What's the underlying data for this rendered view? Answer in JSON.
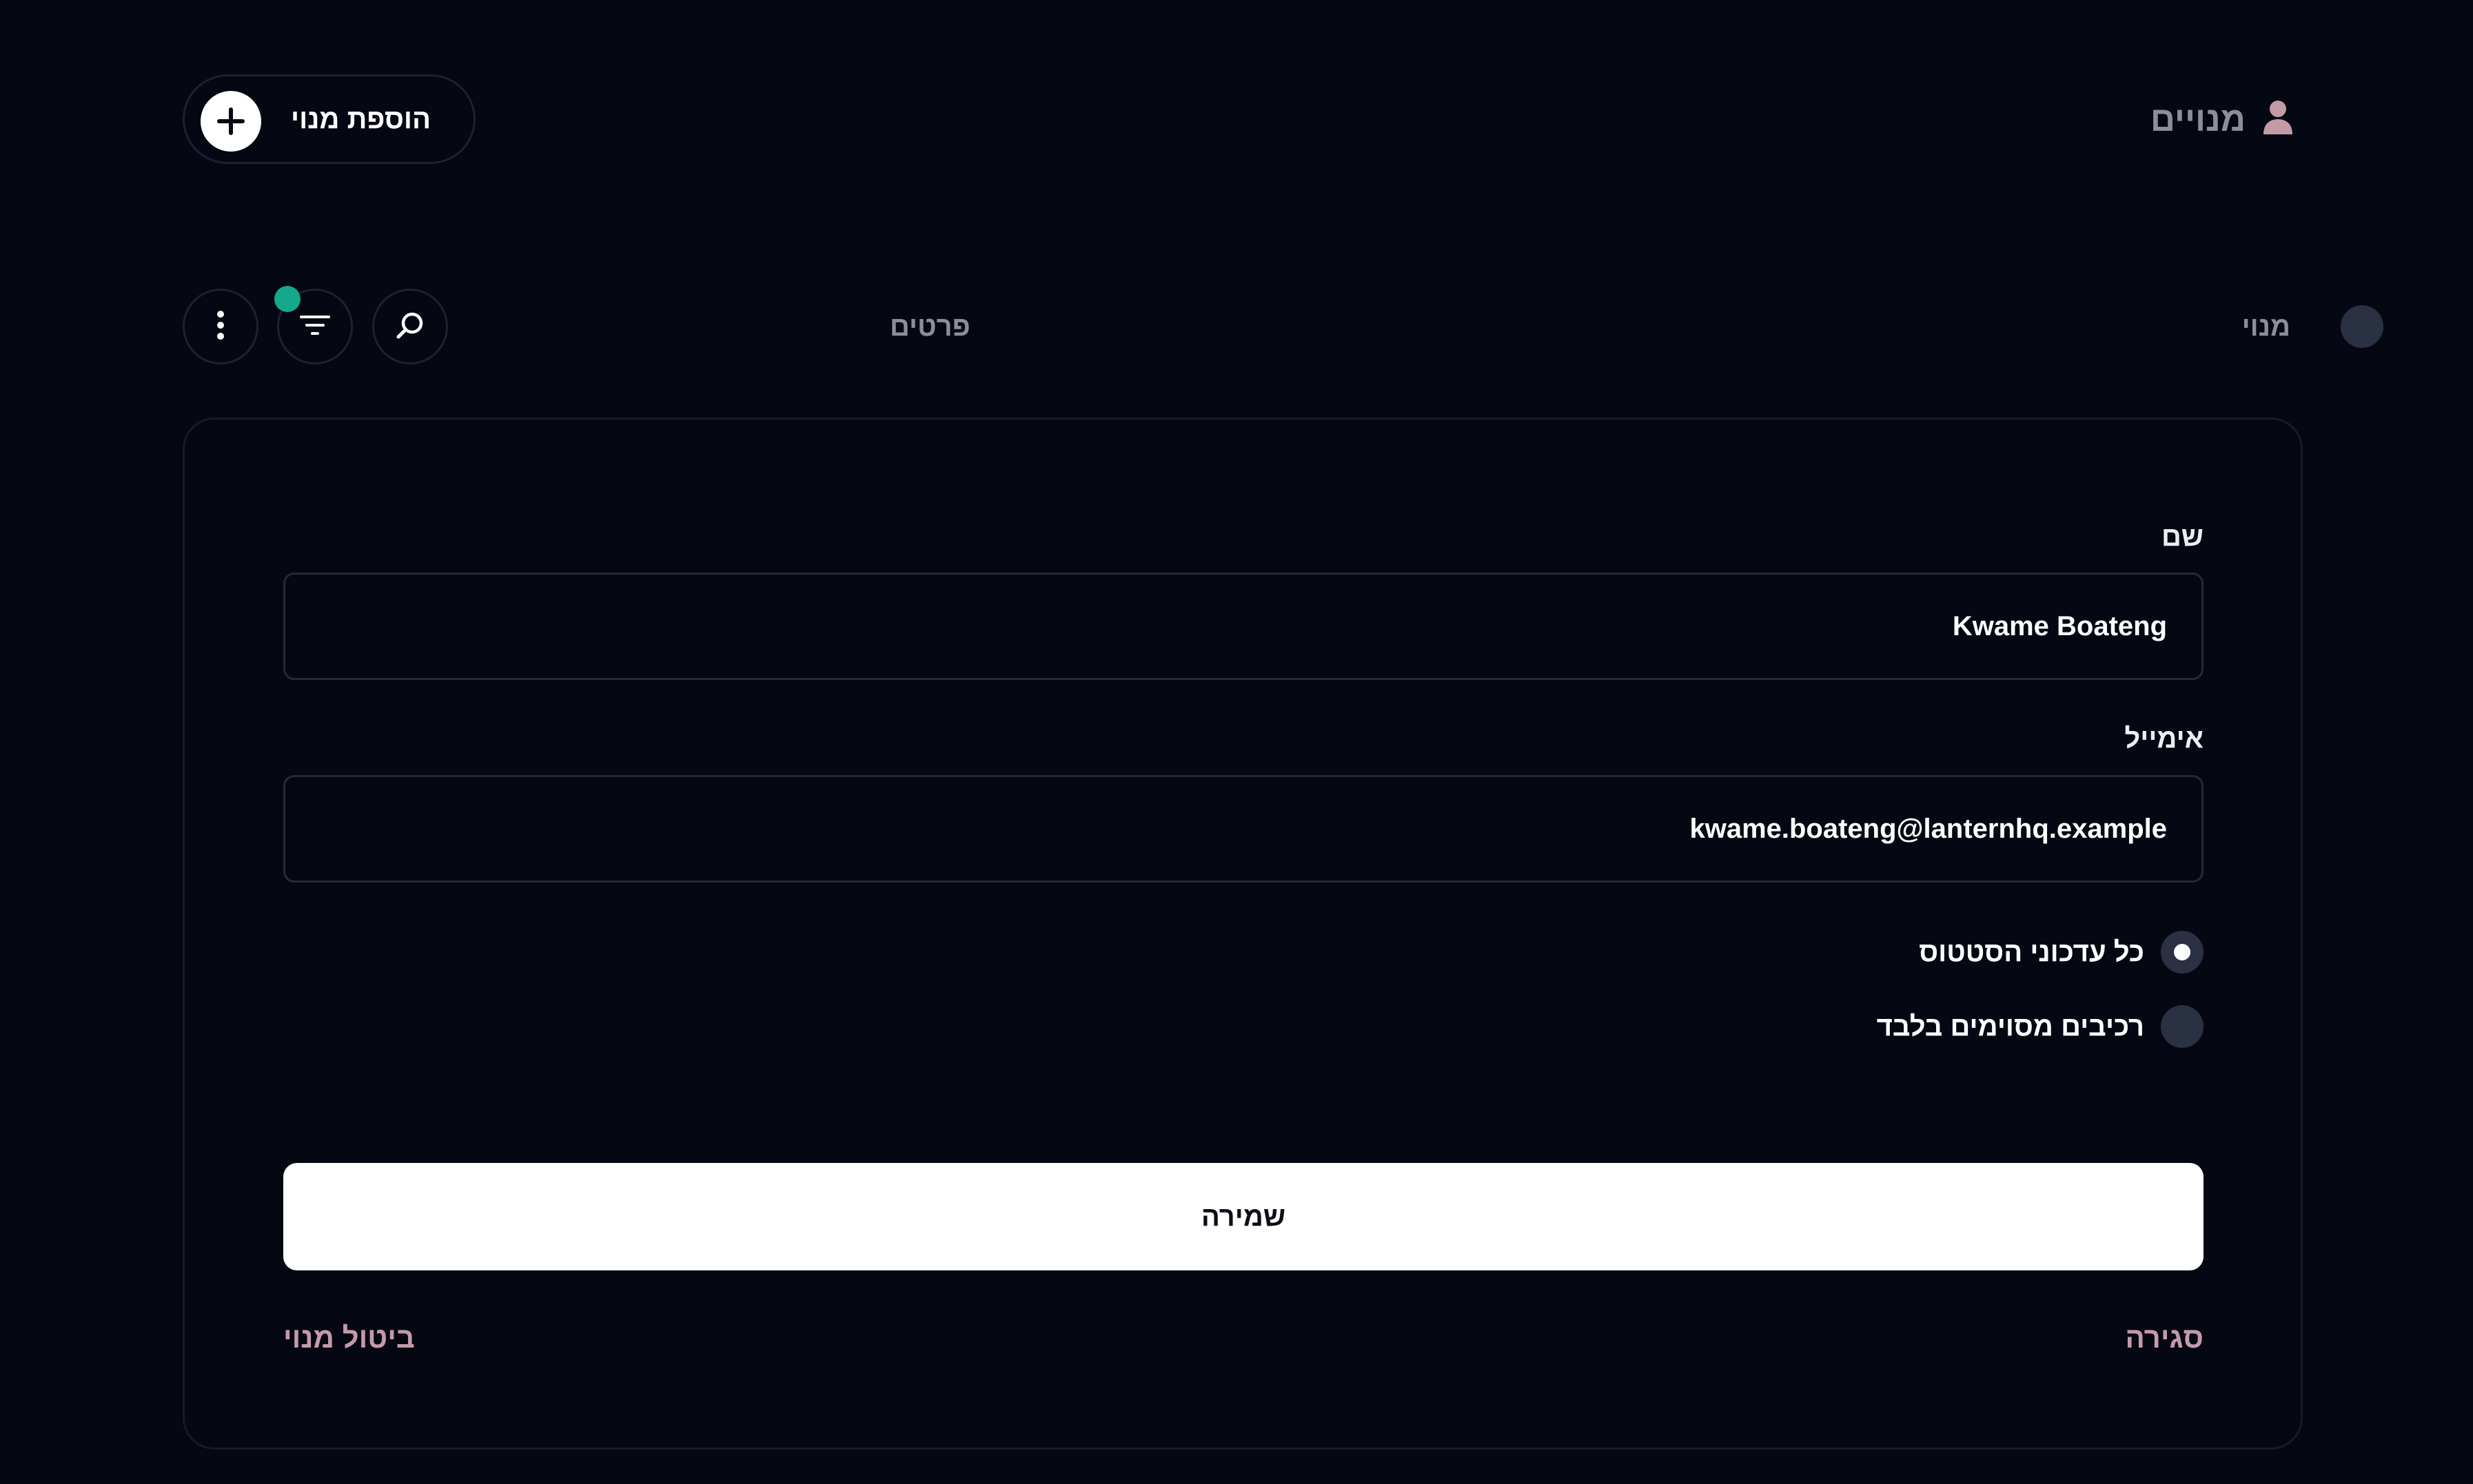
{
  "header": {
    "title": "מנויים",
    "title_icon": "user-icon",
    "add_button_label": "הוספת מנוי",
    "add_button_icon": "plus-icon"
  },
  "toolbar": {
    "columns": {
      "subscriber": "מנוי",
      "details": "פרטים"
    },
    "buttons": [
      "more-vertical-icon",
      "filter-icon",
      "search-icon"
    ],
    "filter_active": true
  },
  "form": {
    "name_label": "שם",
    "name_value": "Kwame Boateng",
    "email_label": "אימייל",
    "email_value": "kwame.boateng@lanternhq.example",
    "options": [
      {
        "label": "כל עדכוני הסטטוס",
        "selected": true
      },
      {
        "label": "רכיבים מסוימים בלבד",
        "selected": false
      }
    ],
    "save_label": "שמירה",
    "close_label": "סגירה",
    "cancel_subscription_label": "ביטול מנוי"
  },
  "colors": {
    "background": "#050813",
    "accent_dot": "#14a98a",
    "link": "#c59aa8",
    "user_icon": "#c49aa6",
    "border": "#1c2232"
  }
}
